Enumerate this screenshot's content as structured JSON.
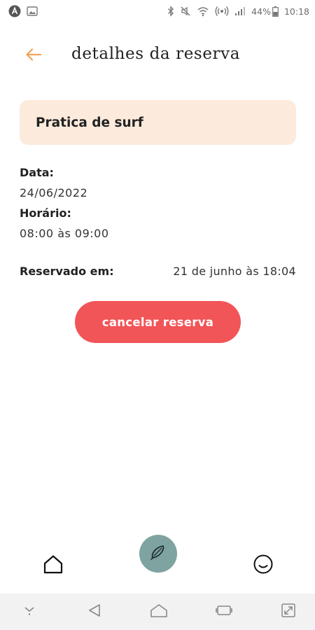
{
  "status_bar": {
    "battery_text": "44%",
    "time": "10:18",
    "icons": [
      "app-logo-icon",
      "image-icon",
      "bluetooth-icon",
      "mute-icon",
      "wifi-icon",
      "hotspot-icon",
      "signal-icon",
      "battery-icon"
    ]
  },
  "header": {
    "back_icon": "arrow-left-icon",
    "title": "detalhes da reserva"
  },
  "activity": {
    "name": "Pratica de surf"
  },
  "details": {
    "date_label": "Data:",
    "date_value": "24/06/2022",
    "time_label": "Horário:",
    "time_value": "08:00 às 09:00",
    "reserved_label": "Reservado em:",
    "reserved_value": "21 de junho às 18:04"
  },
  "actions": {
    "cancel_label": "cancelar reserva"
  },
  "bottom_nav": {
    "items": [
      "home-icon",
      "surfboard-icon",
      "smiley-icon"
    ]
  },
  "system_nav": {
    "items": [
      "down-chevron-icon",
      "back-triangle-icon",
      "home-outline-icon",
      "recents-icon",
      "fullscreen-icon"
    ]
  },
  "colors": {
    "accent_orange": "#f0a35a",
    "card_bg": "#fcebdc",
    "cancel_red": "#f25557",
    "nav_teal": "#7ea3a1"
  }
}
